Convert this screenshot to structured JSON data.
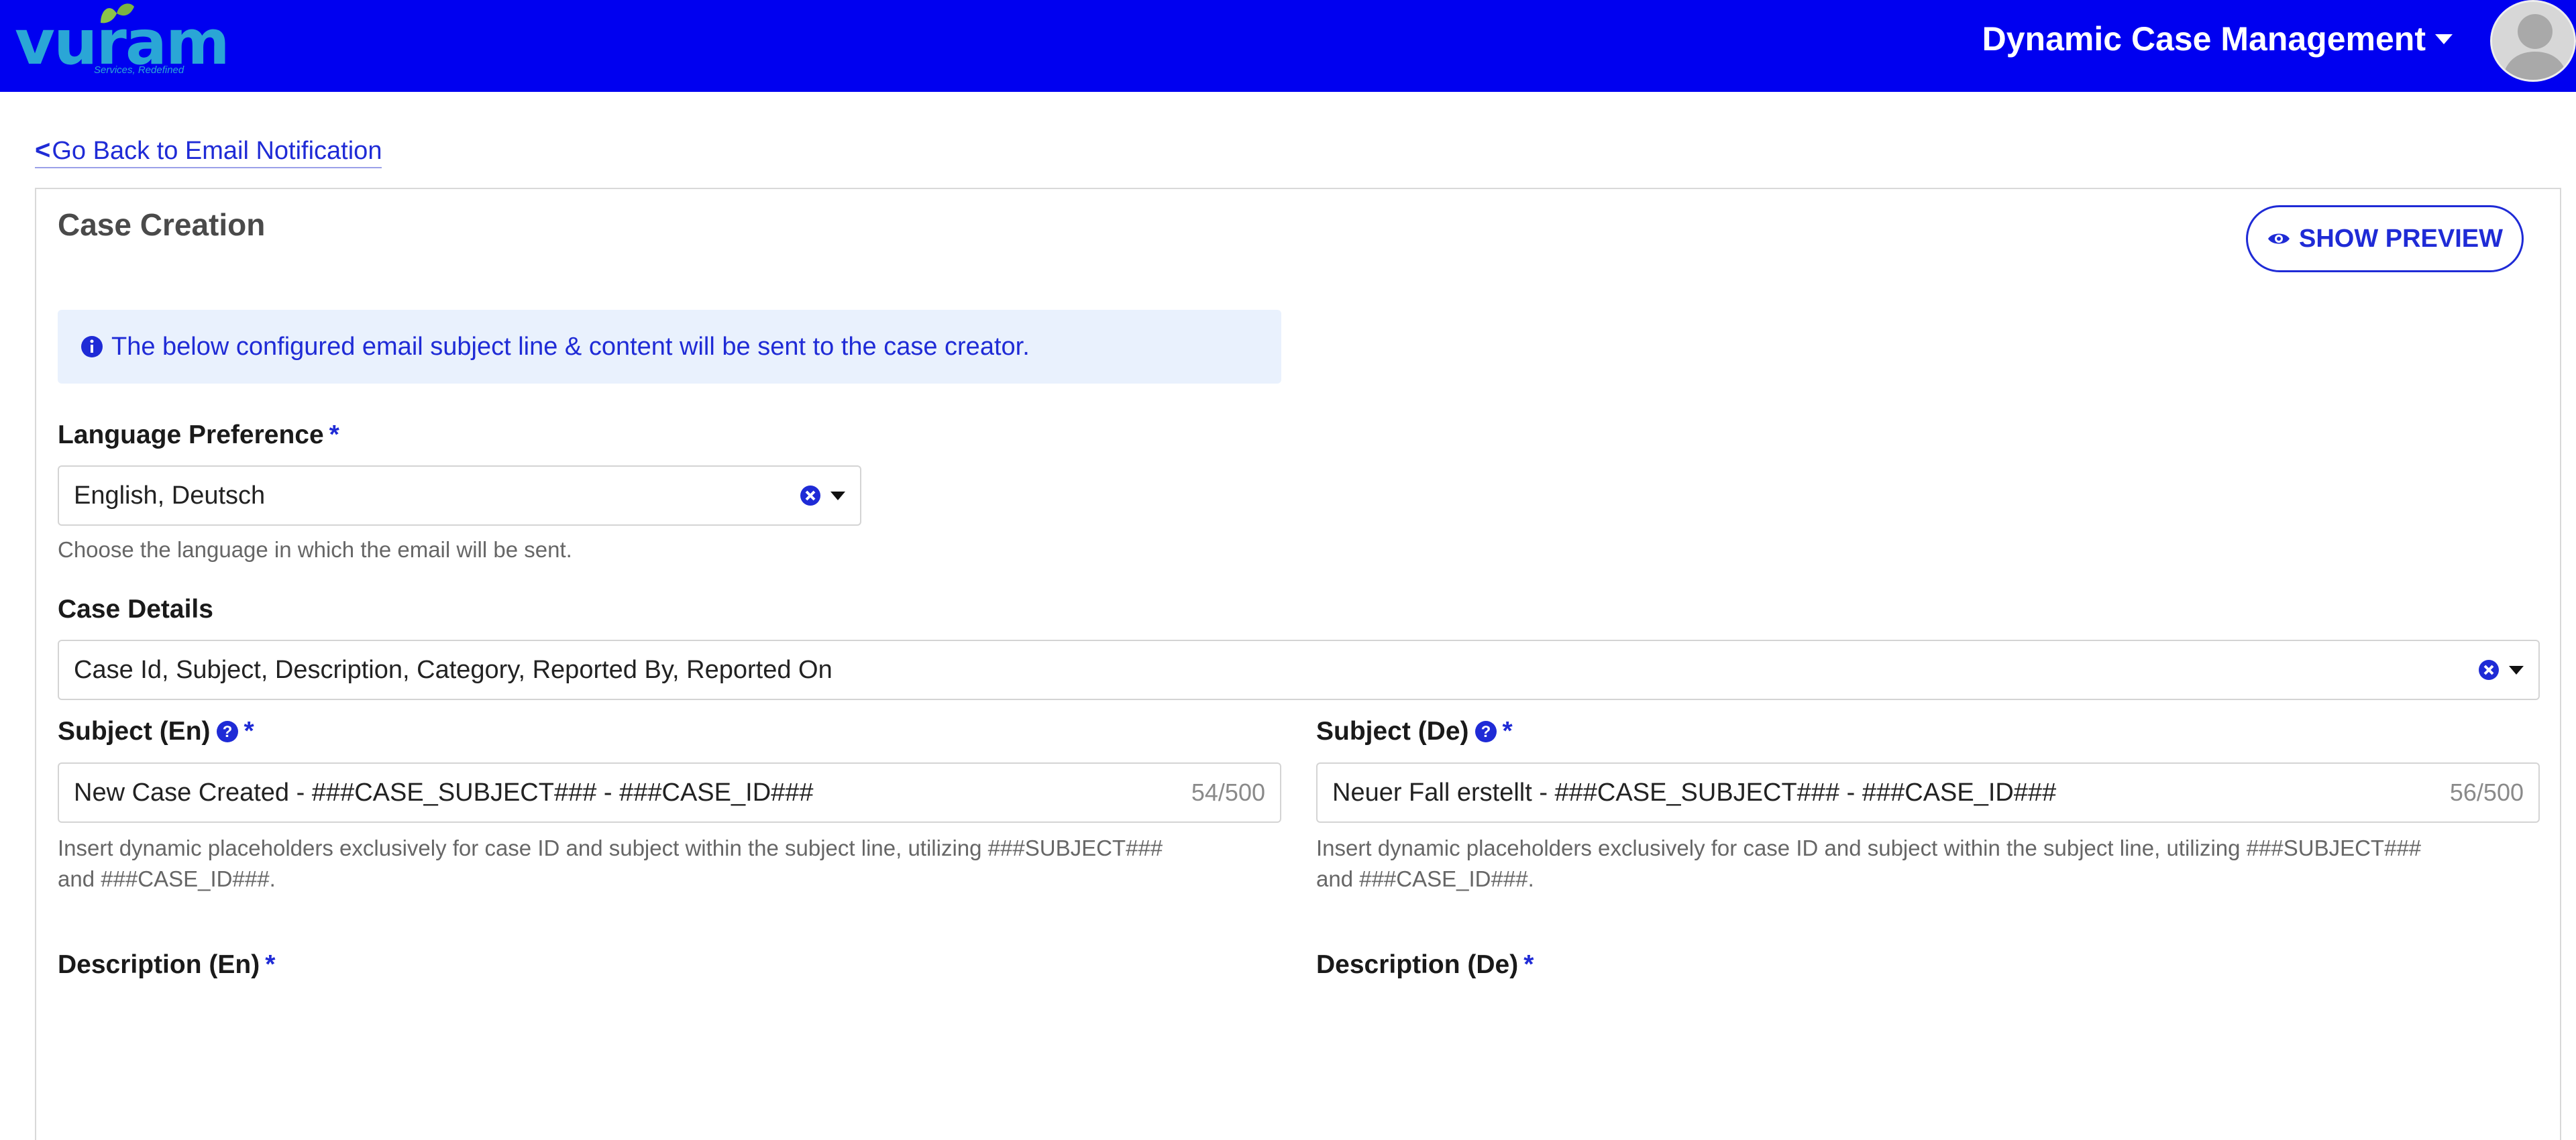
{
  "header": {
    "logo_text": "vuram",
    "logo_tagline": "Services, Redefined",
    "app_title": "Dynamic Case Management"
  },
  "back_link": {
    "label": "Go Back to Email Notification"
  },
  "card": {
    "title": "Case Creation",
    "preview_button_label": "SHOW PREVIEW",
    "info_message": "The below configured email subject line & content will be sent to the case creator."
  },
  "language": {
    "label": "Language Preference",
    "required_mark": "*",
    "value": "English, Deutsch",
    "help": "Choose the language in which the email will be sent."
  },
  "case_details": {
    "label": "Case Details",
    "value": "Case Id, Subject, Description, Category, Reported By, Reported On"
  },
  "subject_en": {
    "label": "Subject (En)",
    "required_mark": "*",
    "value": "New Case Created - ###CASE_SUBJECT### - ###CASE_ID###",
    "counter": "54/500",
    "help_line1": "Insert dynamic placeholders exclusively for case ID and subject within the subject line, utilizing ###SUBJECT###",
    "help_line2": "and ###CASE_ID###."
  },
  "subject_de": {
    "label": "Subject (De)",
    "required_mark": "*",
    "value": "Neuer Fall erstellt - ###CASE_SUBJECT### - ###CASE_ID###",
    "counter": "56/500",
    "help_line1": "Insert dynamic placeholders exclusively for case ID and subject within the subject line, utilizing ###SUBJECT###",
    "help_line2": "and ###CASE_ID###."
  },
  "description_en": {
    "label": "Description (En)",
    "required_mark": "*"
  },
  "description_de": {
    "label": "Description (De)",
    "required_mark": "*"
  },
  "colors": {
    "header_bg": "#0000f0",
    "accent": "#1f2bd6",
    "info_bg": "#e9f1fd"
  },
  "icons": [
    "leaf-logo-icon",
    "chevron-down-icon",
    "user-avatar-icon",
    "chevron-left-icon",
    "eye-icon",
    "info-icon",
    "clear-icon",
    "help-icon"
  ]
}
